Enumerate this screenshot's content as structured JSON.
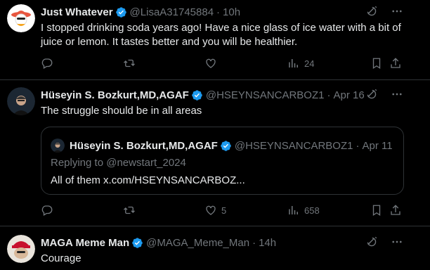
{
  "colors": {
    "background": "#000000",
    "text": "#e7e9ea",
    "muted": "#71767b",
    "divider": "#2f3336",
    "verified": "#1d9bf0"
  },
  "tweets": [
    {
      "name": "Just Whatever",
      "handle": "@LisaA31745884",
      "time": "10h",
      "text": "I stopped drinking soda years ago! Have a nice glass of ice water with a bit of juice or lemon. It tastes better and you will be healthier.",
      "views": "24"
    },
    {
      "name": "Hüseyin S. Bozkurt,MD,AGAF",
      "handle": "@HSEYNSANCARBOZ1",
      "time": "Apr 16",
      "text": "The struggle should be in all areas",
      "likes": "5",
      "views": "658",
      "quote": {
        "name": "Hüseyin S. Bozkurt,MD,AGAF",
        "handle": "@HSEYNSANCARBOZ1",
        "time": "Apr 11",
        "replying_to": "Replying to @newstart_2024",
        "text": "All of them x.com/HSEYNSANCARBOZ..."
      }
    },
    {
      "name": "MAGA Meme Man",
      "handle": "@MAGA_Meme_Man",
      "time": "14h",
      "text": "Courage"
    }
  ],
  "separator": "·",
  "icons": [
    "grok-icon",
    "more-icon",
    "reply-icon",
    "retweet-icon",
    "like-icon",
    "views-icon",
    "bookmark-icon",
    "share-icon",
    "verified-icon"
  ]
}
